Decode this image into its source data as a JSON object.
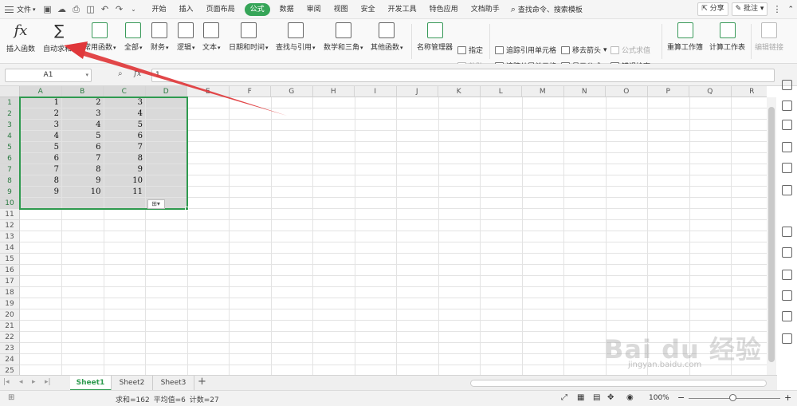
{
  "menubar": {
    "file_label": "文件",
    "tabs": [
      "开始",
      "插入",
      "页面布局",
      "公式",
      "数据",
      "审阅",
      "视图",
      "安全",
      "开发工具",
      "特色应用",
      "文档助手"
    ],
    "active_tab": "公式",
    "search_text": "查找命令、搜索模板",
    "share_label": "分享",
    "comment_label": "批注"
  },
  "ribbon": {
    "insert_function": "插入函数",
    "autosum": "自动求和",
    "common_functions": "常用函数",
    "all": "全部",
    "finance": "财务",
    "logic": "逻辑",
    "text": "文本",
    "datetime": "日期和时间",
    "lookup": "查找与引用",
    "math": "数学和三角",
    "other": "其他函数",
    "name_manager": "名称管理器",
    "specify": "指定",
    "paste": "粘贴",
    "trace_precedents": "追踪引用单元格",
    "trace_dependents": "追踪从属单元格",
    "remove_arrows": "移去箭头",
    "show_formulas": "显示公式",
    "formula_eval": "公式求值",
    "error_check": "错误检查",
    "recalc_workbook": "重算工作簿",
    "calc_sheet": "计算工作表",
    "edit_links": "编辑链接",
    "fx_symbol": "fx",
    "sigma_symbol": "∑"
  },
  "formula_bar": {
    "name_box": "A1",
    "formula": "1"
  },
  "grid": {
    "columns": [
      "A",
      "B",
      "C",
      "D",
      "E",
      "F",
      "G",
      "H",
      "I",
      "J",
      "K",
      "L",
      "M",
      "N",
      "O",
      "P",
      "Q",
      "R"
    ],
    "rows": [
      "1",
      "2",
      "3",
      "4",
      "5",
      "6",
      "7",
      "8",
      "9",
      "10",
      "11",
      "12",
      "13",
      "14",
      "15",
      "16",
      "17",
      "18",
      "19",
      "20",
      "21",
      "22",
      "23",
      "24",
      "25"
    ],
    "data": [
      [
        "1",
        "2",
        "3"
      ],
      [
        "2",
        "3",
        "4"
      ],
      [
        "3",
        "4",
        "5"
      ],
      [
        "4",
        "5",
        "6"
      ],
      [
        "5",
        "6",
        "7"
      ],
      [
        "6",
        "7",
        "8"
      ],
      [
        "7",
        "8",
        "9"
      ],
      [
        "8",
        "9",
        "10"
      ],
      [
        "9",
        "10",
        "11"
      ]
    ]
  },
  "sheets": {
    "tabs": [
      "Sheet1",
      "Sheet2",
      "Sheet3"
    ],
    "active": "Sheet1",
    "add_label": "+"
  },
  "status": {
    "text": "求和=162  平均值=6  计数=27",
    "zoom": "100%"
  },
  "watermark": {
    "main": "Bai du 经验",
    "sub": "jingyan.baidu.com"
  },
  "colors": {
    "accent": "#36a558",
    "arrow": "#e0373a"
  }
}
